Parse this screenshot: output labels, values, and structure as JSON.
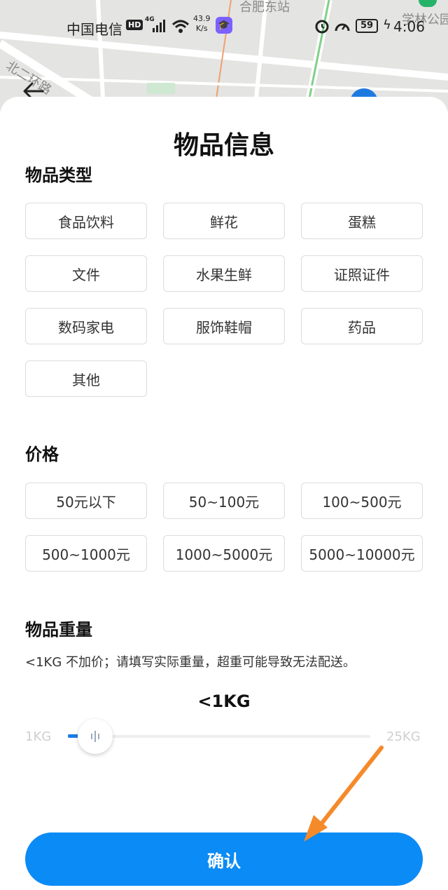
{
  "map": {
    "labels": {
      "station": "合肥东站",
      "road": "北二环路",
      "campus": "学林公园"
    }
  },
  "status_bar": {
    "carrier": "中国电信",
    "hd": "HD",
    "network": "4G",
    "speed_value": "43.9",
    "speed_unit": "K/s",
    "battery": "59",
    "time": "4:06"
  },
  "sheet": {
    "title": "物品信息",
    "item_type": {
      "title": "物品类型",
      "options": [
        "食品饮料",
        "鲜花",
        "蛋糕",
        "文件",
        "水果生鲜",
        "证照证件",
        "数码家电",
        "服饰鞋帽",
        "药品",
        "其他"
      ]
    },
    "price": {
      "title": "价格",
      "options": [
        "50元以下",
        "50~100元",
        "100~500元",
        "500~1000元",
        "1000~5000元",
        "5000~10000元"
      ]
    },
    "weight": {
      "title": "物品重量",
      "note": "<1KG 不加价；请填写实际重量，超重可能导致无法配送。",
      "value": "<1KG",
      "min_label": "1KG",
      "max_label": "25KG",
      "slider_fraction": 0.0
    },
    "confirm_label": "确认"
  },
  "colors": {
    "primary": "#0b8bf5",
    "slider_fill": "#1a7be8",
    "arrow": "#f58a2b"
  }
}
